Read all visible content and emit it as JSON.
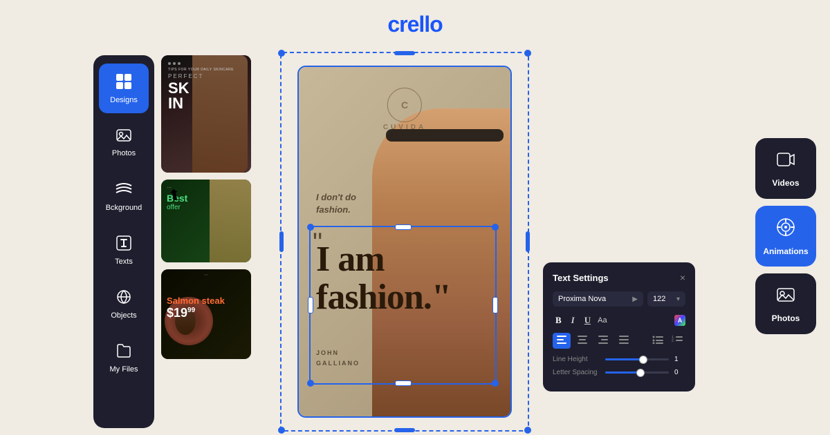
{
  "app": {
    "name": "crello",
    "logo_text": "crello"
  },
  "sidebar": {
    "items": [
      {
        "id": "designs",
        "label": "Designs",
        "icon": "⊞",
        "active": true
      },
      {
        "id": "photos",
        "label": "Photos",
        "icon": "🖼"
      },
      {
        "id": "background",
        "label": "Bckground",
        "icon": "≋"
      },
      {
        "id": "texts",
        "label": "Texts",
        "icon": "T"
      },
      {
        "id": "objects",
        "label": "Objects",
        "icon": "◯"
      },
      {
        "id": "my-files",
        "label": "My Files",
        "icon": "📁"
      }
    ]
  },
  "cards": [
    {
      "id": "skin",
      "title_line1": "SK",
      "title_line2": "IN",
      "subtitle": "Tips for your daily skincare",
      "label": "PERFECT"
    },
    {
      "id": "offer",
      "tag": "BEST",
      "main": "Best",
      "sub": "offer"
    },
    {
      "id": "salmon",
      "title": "Salmon steak",
      "price": "$19",
      "cents": "99"
    }
  ],
  "canvas": {
    "brand": "CUVIDA",
    "logo_letter": "C",
    "tagline_line1": "I don't do",
    "tagline_line2": "fashion.",
    "main_text_line1": "I am",
    "main_text_line2": "fashion.\"",
    "attribution_line1": "JOHN",
    "attribution_line2": "GALLIANO"
  },
  "text_settings": {
    "title": "Text Settings",
    "close_label": "×",
    "font_name": "Proxima Nova",
    "font_size": "122",
    "format_buttons": [
      {
        "id": "bold",
        "label": "B",
        "style": "bold"
      },
      {
        "id": "italic",
        "label": "I",
        "style": "italic"
      },
      {
        "id": "underline",
        "label": "U",
        "style": "underline"
      },
      {
        "id": "aa",
        "label": "Aa"
      },
      {
        "id": "color",
        "label": "A"
      }
    ],
    "align_buttons": [
      {
        "id": "left",
        "label": "≡",
        "active": true
      },
      {
        "id": "center",
        "label": "≡"
      },
      {
        "id": "right",
        "label": "≡"
      },
      {
        "id": "justify",
        "label": "≡"
      }
    ],
    "list_buttons": [
      {
        "id": "bullet",
        "label": "≡"
      },
      {
        "id": "numbered",
        "label": "≡"
      }
    ],
    "sliders": [
      {
        "id": "line-height",
        "label": "Line Height",
        "value": 1,
        "fill_percent": 60
      },
      {
        "id": "letter-spacing",
        "label": "Letter Spacing",
        "value": 0,
        "fill_percent": 55
      }
    ]
  },
  "right_panel": {
    "buttons": [
      {
        "id": "videos",
        "label": "Videos",
        "icon": "▶",
        "style": "dark"
      },
      {
        "id": "animations",
        "label": "Animations",
        "icon": "◉",
        "style": "blue"
      },
      {
        "id": "photos",
        "label": "Photos",
        "icon": "🖼",
        "style": "dark"
      }
    ]
  }
}
